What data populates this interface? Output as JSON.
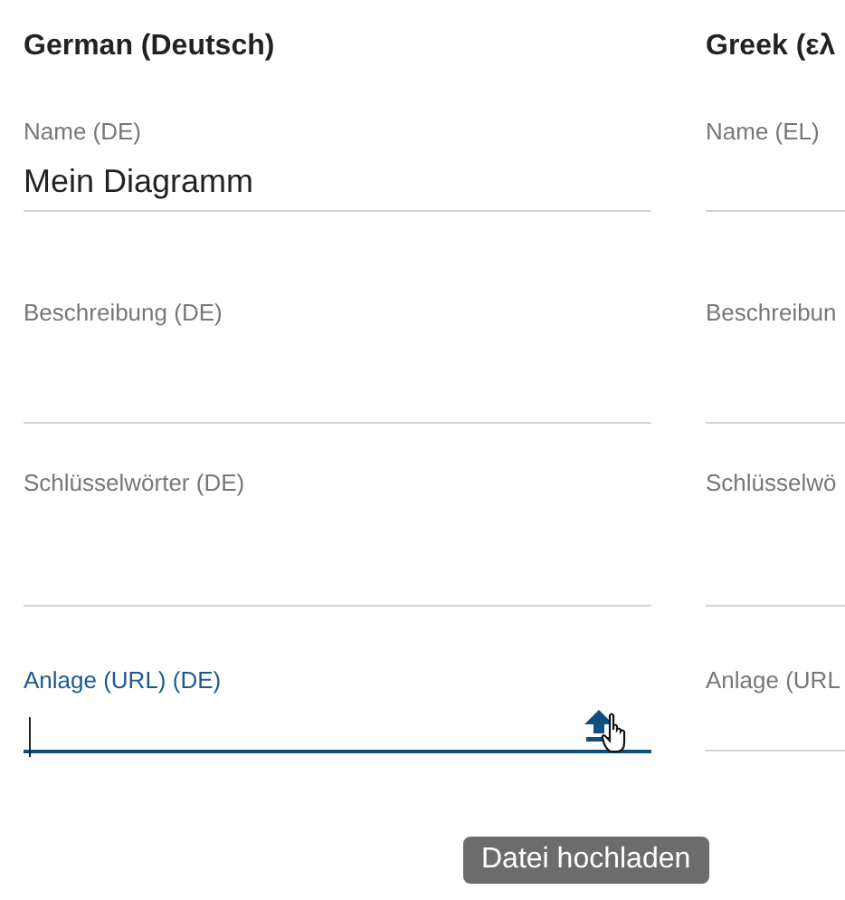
{
  "columns": [
    {
      "heading": "German (Deutsch)",
      "fields": [
        {
          "label": "Name (DE)",
          "value": "Mein Diagramm",
          "focused": false,
          "kind": "text"
        },
        {
          "label": "Beschreibung (DE)",
          "focused": false,
          "kind": "text"
        },
        {
          "label": "Schlüsselwörter (DE)",
          "focused": false,
          "kind": "text"
        },
        {
          "label": "Anlage (URL) (DE)",
          "focused": true,
          "kind": "upload",
          "tooltip": "Datei hochladen"
        }
      ]
    },
    {
      "heading": "Greek (ελ",
      "fields": [
        {
          "label": "Name (EL)",
          "focused": false,
          "kind": "text"
        },
        {
          "label": "Beschreibun",
          "focused": false,
          "kind": "text"
        },
        {
          "label": "Schlüsselwö",
          "focused": false,
          "kind": "text"
        },
        {
          "label": "Anlage (URL",
          "focused": false,
          "kind": "text"
        }
      ]
    }
  ]
}
